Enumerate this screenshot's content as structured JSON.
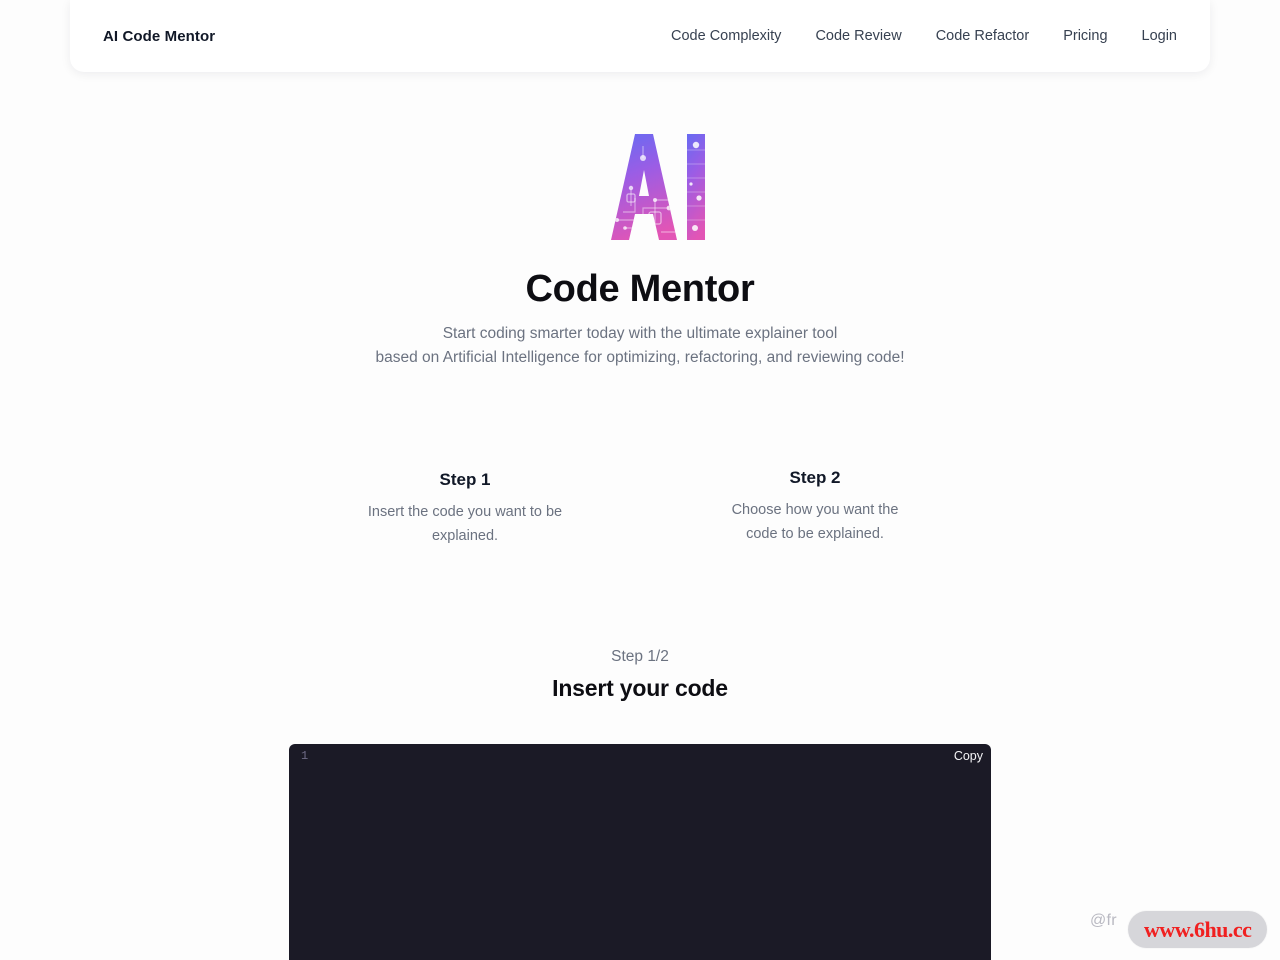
{
  "header": {
    "brand": "AI Code Mentor",
    "nav": [
      {
        "label": "Code Complexity"
      },
      {
        "label": "Code Review"
      },
      {
        "label": "Code Refactor"
      },
      {
        "label": "Pricing"
      },
      {
        "label": "Login"
      }
    ]
  },
  "hero": {
    "logo_text": "AI",
    "logo_alt": "ai-circuit-logo",
    "title": "Code Mentor",
    "subtitle_line1": "Start coding smarter today with the ultimate explainer tool",
    "subtitle_line2": "based on Artificial Intelligence for optimizing, refactoring, and reviewing code!"
  },
  "steps": [
    {
      "title": "Step 1",
      "desc_line1": "Insert the code you want to be",
      "desc_line2": "explained."
    },
    {
      "title": "Step 2",
      "desc_line1": "Choose how you want the",
      "desc_line2": "code to be explained."
    }
  ],
  "stage": {
    "progress_label": "Step 1/2",
    "heading": "Insert your code"
  },
  "editor": {
    "line_number": "1",
    "copy_label": "Copy",
    "code_value": "",
    "code_placeholder": "",
    "background": "#1b1a26"
  },
  "watermark": {
    "handle": "@fr",
    "badge_text": "www.6hu.cc",
    "badge_color": "#f02020",
    "badge_bg": "#d6d6da"
  },
  "colors": {
    "page_bg": "#fdfdfd",
    "header_bg": "#ffffff",
    "text_primary": "#0d0d12",
    "text_muted": "#6b7280",
    "logo_gradient_start": "#5b6ef5",
    "logo_gradient_mid": "#9b5de5",
    "logo_gradient_end": "#e255b5"
  }
}
